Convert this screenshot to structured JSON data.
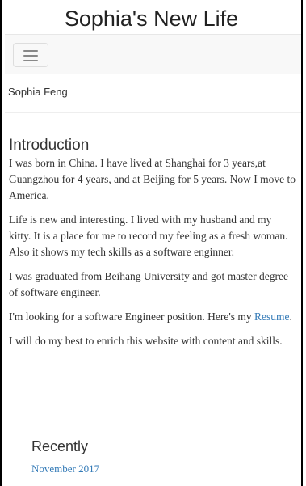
{
  "header": {
    "site_title": "Sophia's New Life"
  },
  "navbar": {
    "toggle_icon": "hamburger-menu-icon"
  },
  "author": {
    "name": "Sophia Feng"
  },
  "intro": {
    "heading": "Introduction",
    "p1": "I was born in China. I have lived at Shanghai for 3 years,at Guangzhou for 4 years, and at Beijing for 5 years. Now I move to America.",
    "p2": "Life is new and interesting. I lived with my husband and my kitty. It is a place for me to record my feeling as a fresh woman. Also it shows my tech skills as a software enginner.",
    "p3": "I was graduated from Beihang University and got master degree of software engineer.",
    "p4_prefix": "I'm looking for a software Engineer position. Here's my ",
    "p4_link": "Resume",
    "p4_suffix": ".",
    "p5": "I will do my best to enrich this website with content and skills."
  },
  "recently": {
    "heading": "Recently",
    "items": [
      {
        "label": "November 2017"
      }
    ]
  },
  "colors": {
    "link": "#337ab7",
    "navbar_bg": "#f8f8f8",
    "text": "#333333"
  }
}
